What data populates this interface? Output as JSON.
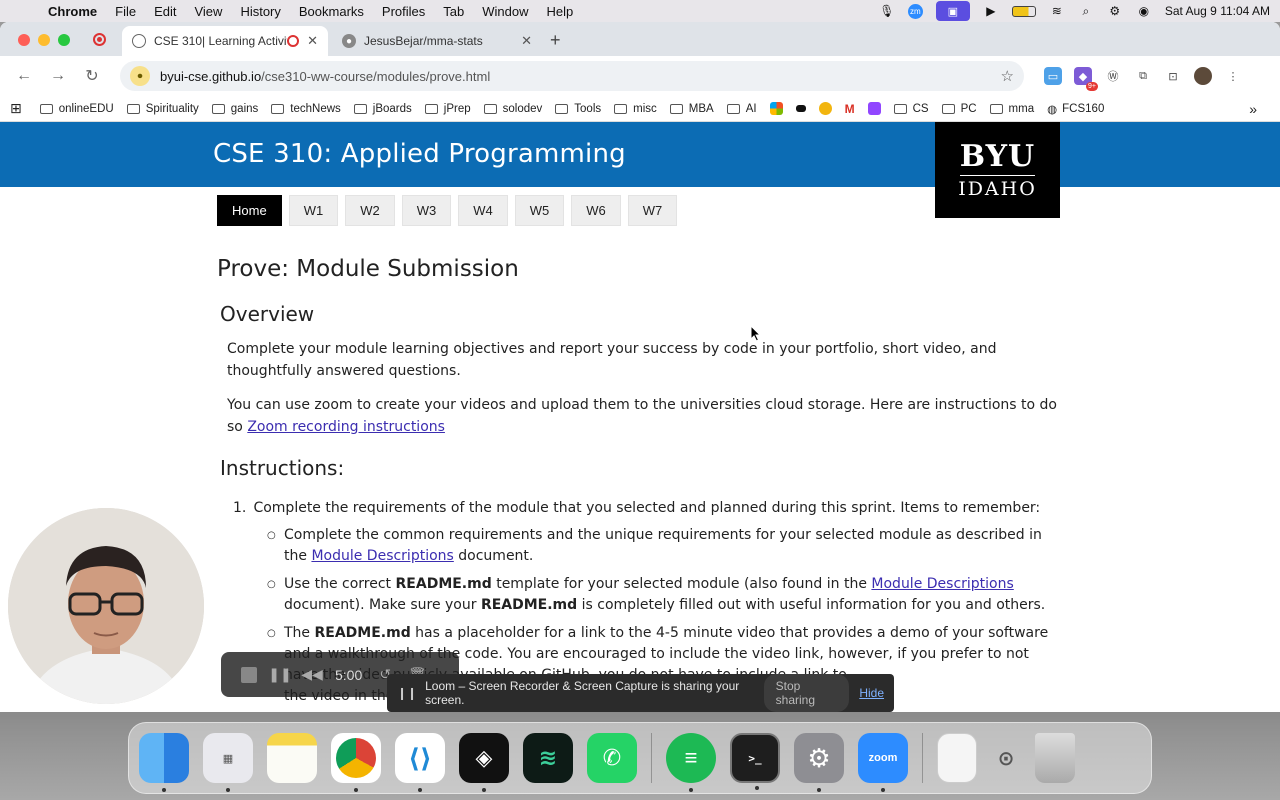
{
  "menubar": {
    "app": "Chrome",
    "items": [
      "File",
      "Edit",
      "View",
      "History",
      "Bookmarks",
      "Profiles",
      "Tab",
      "Window",
      "Help"
    ],
    "clock": "Sat Aug 9  11:04 AM"
  },
  "tabs": [
    {
      "title": "CSE 310| Learning Activiti"
    },
    {
      "title": "JesusBejar/mma-stats"
    }
  ],
  "omnibox": {
    "host": "byui-cse.github.io",
    "path": "/cse310-ww-course/modules/prove.html"
  },
  "extensions": {
    "badge": "9+"
  },
  "bookmarks": [
    "onlineEDU",
    "Spirituality",
    "gains",
    "techNews",
    "jBoards",
    "jPrep",
    "solodev",
    "Tools",
    "misc",
    "MBA",
    "AI",
    "CS",
    "PC",
    "mma",
    "FCS160"
  ],
  "page": {
    "banner_title": "CSE 310: Applied Programming",
    "logo_line1": "BYU",
    "logo_line2": "IDAHO",
    "nav": [
      "Home",
      "W1",
      "W2",
      "W3",
      "W4",
      "W5",
      "W6",
      "W7"
    ],
    "heading": "Prove: Module Submission",
    "overview_heading": "Overview",
    "overview_p1": "Complete your module learning objectives and report your success by code in your portfolio, short video, and thoughtfully answered questions.",
    "overview_p2_text": "You can use zoom to create your videos and upload them to the universities cloud storage. Here are instructions to do so ",
    "overview_p2_link": "Zoom recording instructions",
    "instructions_heading": "Instructions:",
    "step1_num": "1.",
    "step1": "Complete the requirements of the module that you selected and planned during this sprint.  Items to remember:",
    "bullet1_a": "Complete the common requirements and the unique requirements for your selected module as described in the ",
    "bullet1_link": "Module Descriptions",
    "bullet1_b": " document.",
    "bullet2_a": "Use the correct ",
    "bullet2_bold1": "README.md",
    "bullet2_b": " template for your selected module (also found in the ",
    "bullet2_link": "Module Descriptions",
    "bullet2_c": " document).  Make sure your ",
    "bullet2_bold2": "README.md",
    "bullet2_d": " is completely filled out with useful information for you and others.",
    "bullet3_a": "The ",
    "bullet3_bold": "README.md",
    "bullet3_b": " has a placeholder for a link to the 4-5 minute video that provides a demo of your software",
    "bullet3_line2": "and a walkthrough of the code.  You are encouraged to include the video link, however, if you prefer to not",
    "bullet3_line3": "have the video publicly available on GitHub, you do not have to include a link to",
    "bullet3_line4": "the video in the README.md file.  Instead, include the link when you submit the"
  },
  "loom": {
    "timer": "5:00",
    "share_text": "Loom – Screen Recorder & Screen Capture is sharing your screen.",
    "stop_label": "Stop sharing",
    "hide_label": "Hide"
  },
  "dock": {
    "apps": [
      "finder-icon",
      "launchpad-icon",
      "notes-icon",
      "chrome-icon",
      "vscode-icon",
      "unity-icon",
      "app-icon",
      "whatsapp-icon",
      "spotify-icon",
      "terminal-icon",
      "settings-icon",
      "zoom-icon",
      "file-icon",
      "trash-icon"
    ],
    "zoom_label": "zoom"
  }
}
